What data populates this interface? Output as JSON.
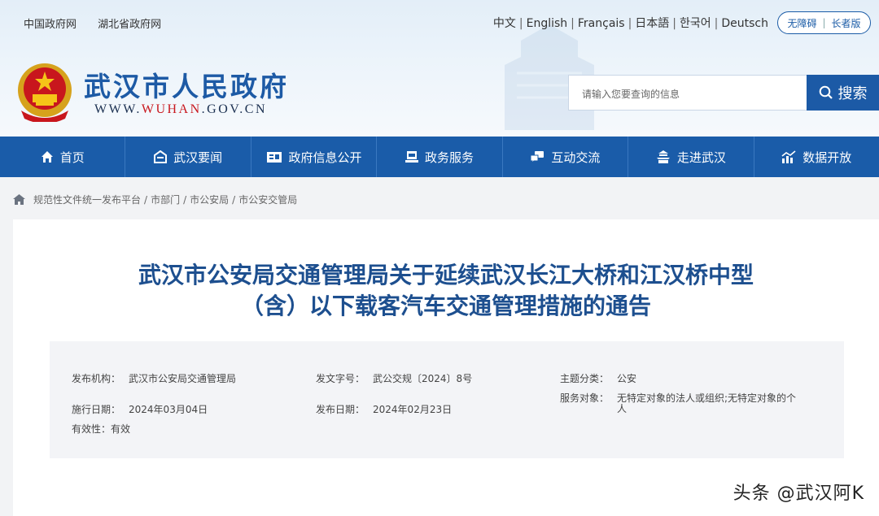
{
  "top_links": [
    "中国政府网",
    "湖北省政府网"
  ],
  "languages": [
    "中文",
    "English",
    "Français",
    "日本語",
    "한국어",
    "Deutsch"
  ],
  "accessibility": {
    "barrier_free": "无障碍",
    "elder": "长者版"
  },
  "site": {
    "title": "武汉市人民政府",
    "url_prefix": "WWW.",
    "url_highlight": "WUHAN",
    "url_suffix": ".GOV.CN"
  },
  "search": {
    "placeholder": "请输入您要查询的信息",
    "button": "搜索"
  },
  "nav": [
    {
      "label": "首页",
      "icon": "home-icon"
    },
    {
      "label": "武汉要闻",
      "icon": "news-icon"
    },
    {
      "label": "政府信息公开",
      "icon": "info-public-icon"
    },
    {
      "label": "政务服务",
      "icon": "service-icon"
    },
    {
      "label": "互动交流",
      "icon": "interaction-icon"
    },
    {
      "label": "走进武汉",
      "icon": "city-icon"
    },
    {
      "label": "数据开放",
      "icon": "data-chart-icon"
    }
  ],
  "breadcrumb": [
    "规范性文件统一发布平台",
    "市部门",
    "市公安局",
    "市公安交管局"
  ],
  "document": {
    "title_line1": "武汉市公安局交通管理局关于延续武汉长江大桥和江汉桥中型",
    "title_line2": "（含）以下载客汽车交通管理措施的通告"
  },
  "meta": {
    "issuer_label": "发布机构：",
    "issuer": "武汉市公安局交通管理局",
    "doc_no_label": "发文字号：",
    "doc_no": "武公交规〔2024〕8号",
    "topic_label": "主题分类：",
    "topic": "公安",
    "effective_label": "施行日期：",
    "effective": "2024年03月04日",
    "publish_label": "发布日期：",
    "publish": "2024年02月23日",
    "audience_label": "服务对象：",
    "audience": "无特定对象的法人或组织;无特定对象的个人",
    "validity_label": "有效性：",
    "validity": "有效"
  },
  "watermark": "头条 @武汉阿K",
  "colors": {
    "primary_blue": "#1a5ca9",
    "title_blue": "#1d4f8f",
    "url_red": "#c8161d"
  }
}
